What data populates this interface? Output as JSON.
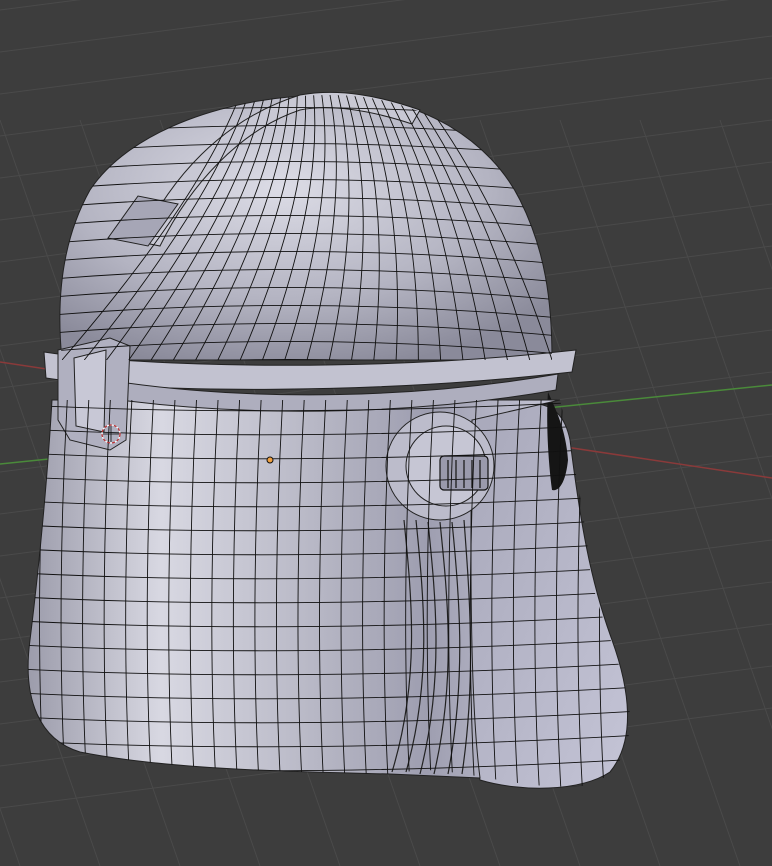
{
  "viewport": {
    "background": "#3d3d3d",
    "grid_color": "#4a4a4a",
    "x_axis_color": "#9a3a3a",
    "y_axis_color": "#4a8a3a",
    "mesh_fill": "#b8b8c6",
    "mesh_shadow": "#8e8e9e",
    "wire_color": "#111111",
    "visor_color": "#151515"
  },
  "objects": {
    "mesh_name": "helmet-mesh",
    "cursor_icon": "3d-cursor-icon",
    "origin_icon": "object-origin-icon"
  }
}
